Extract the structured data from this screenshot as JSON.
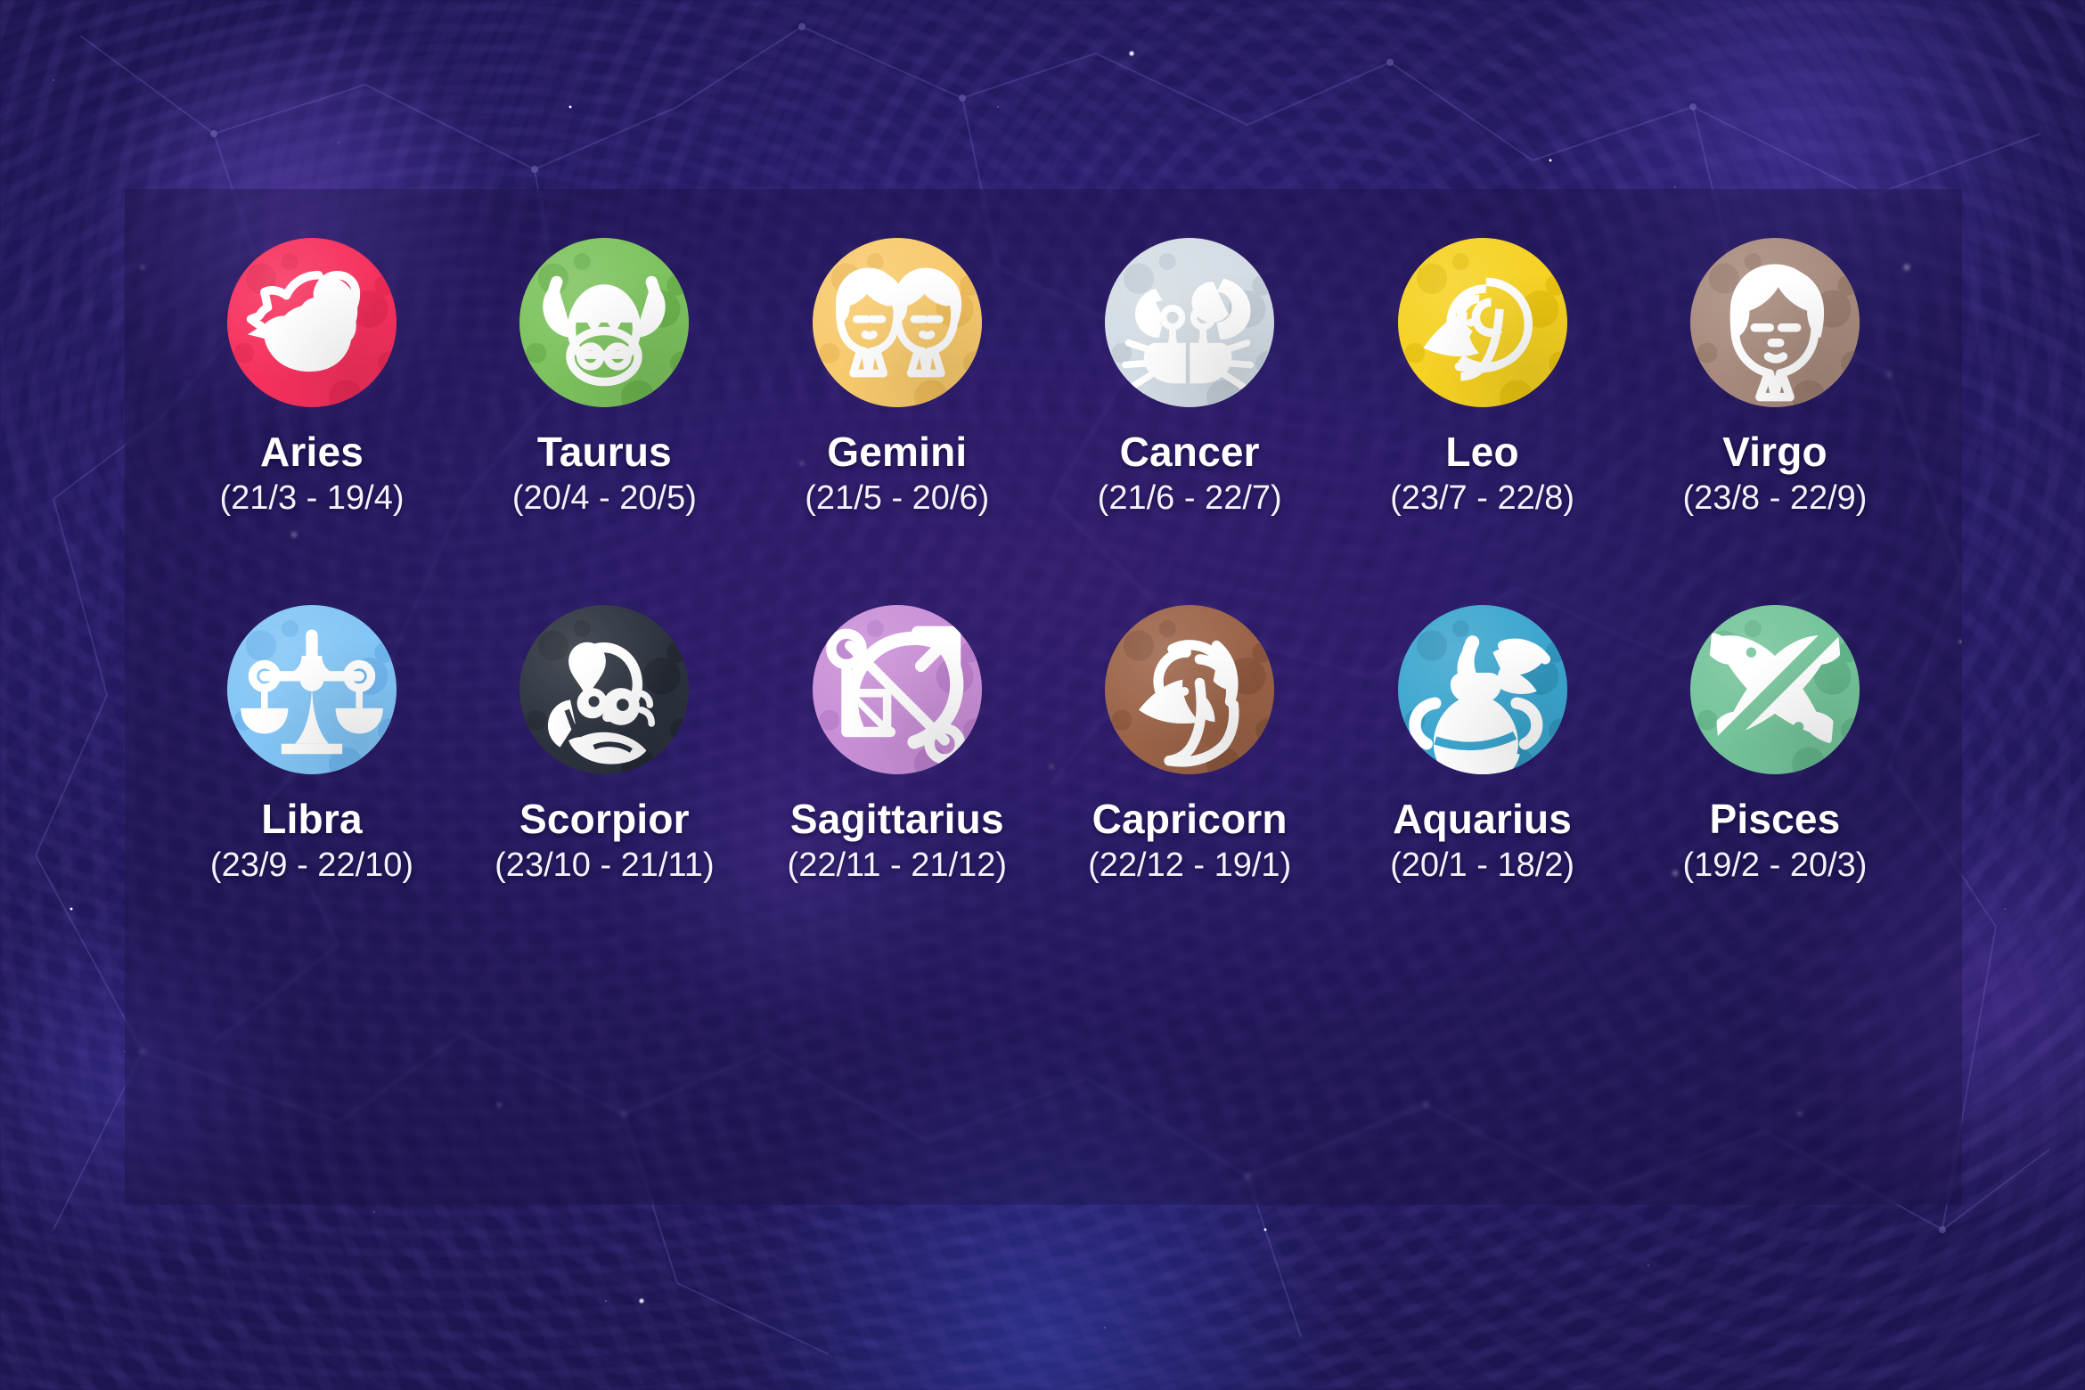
{
  "poster": {
    "background_color": "#2a1d6e",
    "panel_overlay_color": "rgba(26,14,62,0.34)"
  },
  "rows": [
    {
      "signs": [
        {
          "name": "Aries",
          "dates": "(21/3 - 19/4)",
          "color": "#F7315E",
          "crater_color": "#E92A55",
          "icon": "ram-icon",
          "icon_color": "#FFFFFF"
        },
        {
          "name": "Taurus",
          "dates": "(20/4 - 20/5)",
          "color": "#7DC35E",
          "crater_color": "#6BB24D",
          "icon": "bull-icon",
          "icon_color": "#FFFFFF"
        },
        {
          "name": "Gemini",
          "dates": "(21/5 - 20/6)",
          "color": "#F8CA6D",
          "crater_color": "#EEBC5B",
          "icon": "twins-icon",
          "icon_color": "#FFFFFF"
        },
        {
          "name": "Cancer",
          "dates": "(21/6 - 22/7)",
          "color": "#D4DDE4",
          "crater_color": "#C2CDD6",
          "icon": "crab-icon",
          "icon_color": "#FFFFFF"
        },
        {
          "name": "Leo",
          "dates": "(23/7 - 22/8)",
          "color": "#F6D222",
          "crater_color": "#E8C310",
          "icon": "lion-icon",
          "icon_color": "#FFFFFF"
        },
        {
          "name": "Virgo",
          "dates": "(23/8 - 22/9)",
          "color": "#A88B7D",
          "crater_color": "#997C6E",
          "icon": "maiden-icon",
          "icon_color": "#FFFFFF"
        }
      ]
    },
    {
      "signs": [
        {
          "name": "Libra",
          "dates": "(23/9 - 22/10)",
          "color": "#82C5F6",
          "crater_color": "#6FB6EE",
          "icon": "scales-icon",
          "icon_color": "#FFFFFF"
        },
        {
          "name": "Scorpior",
          "dates": "(23/10 - 21/11)",
          "color": "#2C323E",
          "crater_color": "#242932",
          "icon": "scorpion-icon",
          "icon_color": "#FFFFFF"
        },
        {
          "name": "Sagittarius",
          "dates": "(22/11 - 21/12)",
          "color": "#C98FD7",
          "crater_color": "#BA7ECA",
          "icon": "bow-arrow-icon",
          "icon_color": "#FFFFFF"
        },
        {
          "name": "Capricorn",
          "dates": "(22/12 - 19/1)",
          "color": "#9B6348",
          "crater_color": "#8B563D",
          "icon": "goat-icon",
          "icon_color": "#FFFFFF"
        },
        {
          "name": "Aquarius",
          "dates": "(20/1 - 18/2)",
          "color": "#3CA6CF",
          "crater_color": "#3195BD",
          "icon": "water-jug-icon",
          "icon_color": "#FFFFFF"
        },
        {
          "name": "Pisces",
          "dates": "(19/2 - 20/3)",
          "color": "#74C49A",
          "crater_color": "#63B489",
          "icon": "fish-icon",
          "icon_color": "#FFFFFF"
        }
      ]
    }
  ]
}
